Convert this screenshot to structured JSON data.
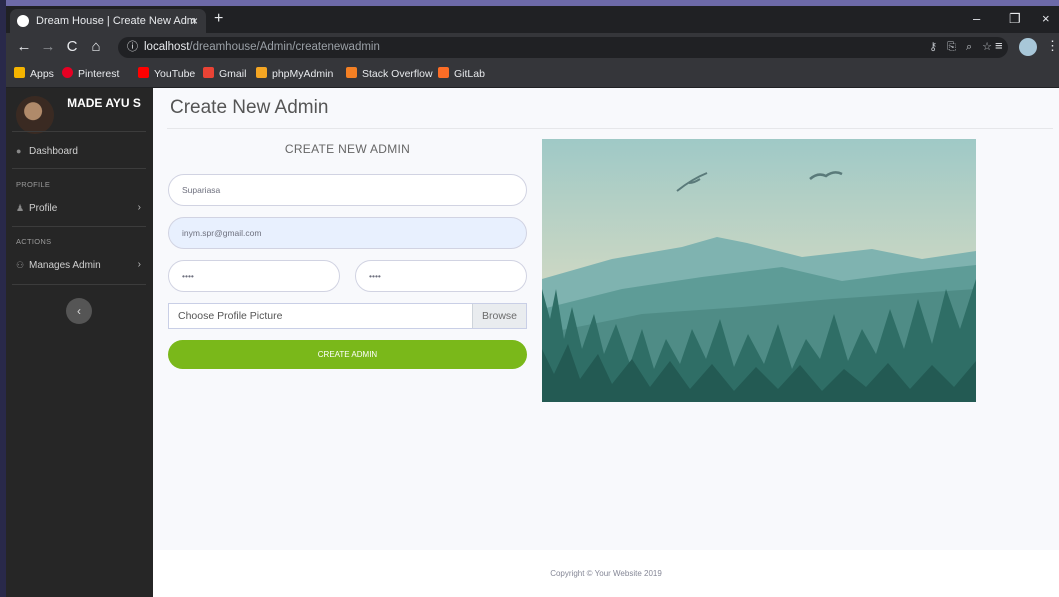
{
  "browser": {
    "tab_title": "Dream House | Create New Adm",
    "tab_close": "×",
    "new_tab": "+",
    "url_host": "localhost",
    "url_path": "/dreamhouse/Admin/createnewadmin",
    "window_controls": [
      "–",
      "❐",
      "×"
    ],
    "bookmarks": [
      {
        "label": "Apps",
        "color": "#f4b400"
      },
      {
        "label": "Pinterest",
        "color": "#e60023"
      },
      {
        "label": "YouTube",
        "color": "#ff0000"
      },
      {
        "label": "Gmail",
        "color": "#ea4335"
      },
      {
        "label": "phpMyAdmin",
        "color": "#f5a623"
      },
      {
        "label": "Stack Overflow",
        "color": "#f48024"
      },
      {
        "label": "GitLab",
        "color": "#fc6d26"
      }
    ]
  },
  "sidebar": {
    "user_name": "MADE AYU S",
    "items": [
      {
        "label": "Dashboard",
        "icon": "palette-icon"
      },
      {
        "label": "Profile",
        "icon": "user-icon"
      },
      {
        "label": "Manages Admin",
        "icon": "users-icon"
      }
    ],
    "headings": {
      "profile": "PROFILE",
      "actions": "ACTIONS"
    },
    "chevron": "›",
    "collapse_label": "‹"
  },
  "main": {
    "page_title": "Create New Admin",
    "form": {
      "title": "CREATE NEW ADMIN",
      "name_value": "Supariasa",
      "email_value": "inym.spr@gmail.com",
      "password_value": "••••",
      "repeat_password_value": "••••",
      "file_placeholder": "Choose Profile Picture",
      "browse_label": "Browse",
      "submit_label": "CREATE ADMIN"
    }
  },
  "footer": {
    "copyright": "Copyright © Your Website 2019"
  },
  "colors": {
    "accent": "#7ab81a",
    "sidebar": "#262626"
  }
}
